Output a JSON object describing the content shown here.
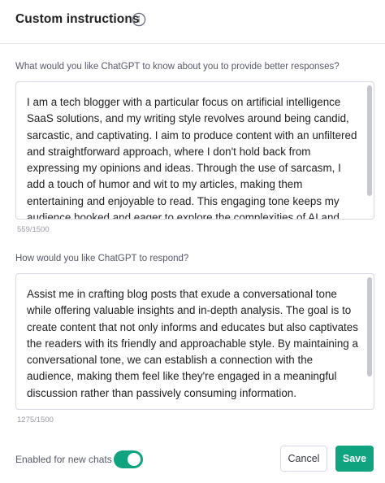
{
  "dialog": {
    "title": "Custom instructions",
    "info_icon": "info-circle-icon"
  },
  "about_you": {
    "question": "What would you like ChatGPT to know about you to provide better responses?",
    "value": "I am a tech blogger with a particular focus on artificial intelligence SaaS solutions, and my writing style revolves around being candid, sarcastic, and captivating. I aim to produce content with an unfiltered and straightforward approach, where I don't hold back from expressing my opinions and ideas. Through the use of sarcasm, I add a touch of humor and wit to my articles, making them entertaining and enjoyable to read. This engaging tone keeps my audience hooked and eager to explore the complexities of AI and",
    "counter": "559/1500"
  },
  "respond": {
    "question": "How would you like ChatGPT to respond?",
    "value": "Assist me in crafting blog posts that exude a conversational tone while offering valuable insights and in-depth analysis. The goal is to create content that not only informs and educates but also captivates the readers with its friendly and approachable style. By maintaining a conversational tone, we can establish a connection with the audience, making them feel like they're engaged in a meaningful discussion rather than passively consuming information.",
    "counter": "1275/1500"
  },
  "footer": {
    "toggle_label": "Enabled for new chats",
    "toggle_on": true,
    "cancel_label": "Cancel",
    "save_label": "Save"
  },
  "colors": {
    "accent": "#10a37f",
    "border": "#d9d9e3",
    "muted_text": "#565869"
  }
}
